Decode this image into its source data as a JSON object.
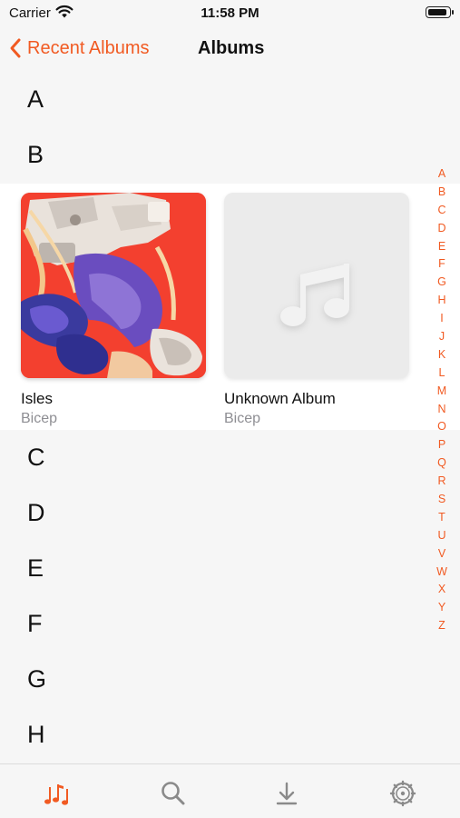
{
  "status_bar": {
    "carrier": "Carrier",
    "time": "11:58 PM",
    "battery_level": 0.95
  },
  "nav": {
    "back_label": "Recent Albums",
    "title": "Albums"
  },
  "sections_top": [
    "A",
    "B"
  ],
  "albums": [
    {
      "title": "Isles",
      "artist": "Bicep",
      "artwork": "isles-cover-art"
    },
    {
      "title": "Unknown Album",
      "artist": "Bicep",
      "artwork": "music-note-placeholder-icon"
    }
  ],
  "sections_bottom": [
    "C",
    "D",
    "E",
    "F",
    "G",
    "H"
  ],
  "index_letters": [
    "A",
    "B",
    "C",
    "D",
    "E",
    "F",
    "G",
    "H",
    "I",
    "J",
    "K",
    "L",
    "M",
    "N",
    "O",
    "P",
    "Q",
    "R",
    "S",
    "T",
    "U",
    "V",
    "W",
    "X",
    "Y",
    "Z"
  ],
  "tabs": [
    {
      "name": "music-notes-icon",
      "selected": true
    },
    {
      "name": "search-icon",
      "selected": false
    },
    {
      "name": "download-icon",
      "selected": false
    },
    {
      "name": "settings-gear-icon",
      "selected": false
    }
  ],
  "colors": {
    "accent": "#f15a22",
    "background": "#f6f6f6",
    "secondary_text": "#8e8e93",
    "tab_inactive": "#8a8a8a"
  }
}
